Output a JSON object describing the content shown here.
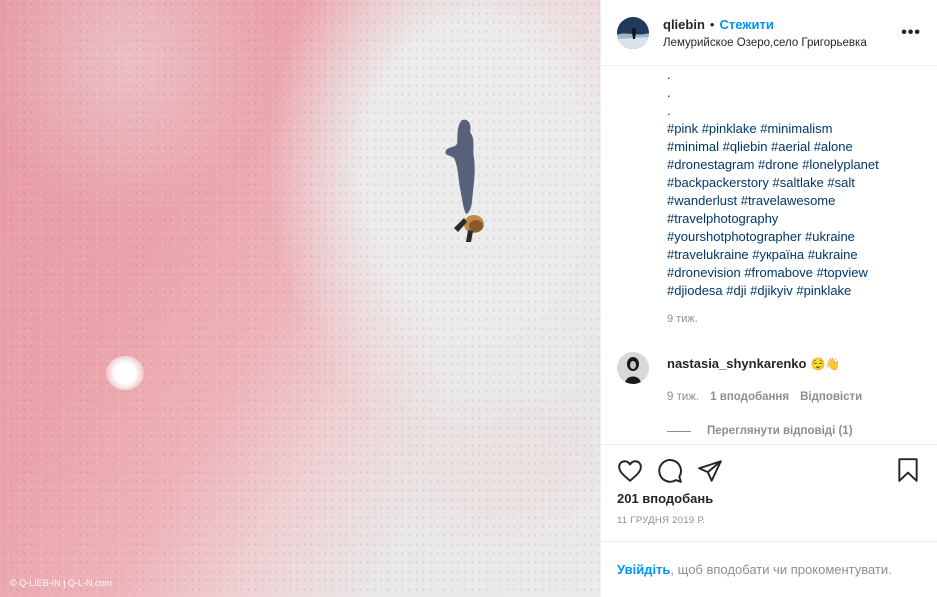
{
  "photo": {
    "watermark": "© Q-LIEB-IN | Q-L-N.com"
  },
  "header": {
    "username": "qliebin",
    "separator": "•",
    "follow_label": "Стежити",
    "location": "Лемурийское Озеро,село Григорьевка",
    "more_label": "•••"
  },
  "caption": {
    "dots": [
      ".",
      ".",
      "."
    ],
    "hashtag_lines": [
      "#pink #pinklake #minimalism",
      "#minimal #qliebin #aerial #alone",
      "#dronestagram #drone #lonelyplanet",
      "#backpackerstory #saltlake #salt",
      "#wanderlust #travelawesome",
      "#travelphotography",
      "#yourshotphotographer #ukraine",
      "#travelukraine #україна #ukraine",
      "#dronevision #fromabove #topview",
      "#djiodesa #dji #djikyiv #pinklake"
    ],
    "time_ago": "9 тиж."
  },
  "comment": {
    "username": "nastasia_shynkarenko",
    "emoji": "😌👋",
    "time_ago": "9 тиж.",
    "likes": "1 вподобання",
    "reply_label": "Відповісти",
    "view_replies": "Переглянути відповіді (1)"
  },
  "actions": {
    "icons": [
      "heart-icon",
      "comment-icon",
      "share-icon",
      "bookmark-icon"
    ],
    "likes_count": "201 вподобань",
    "date": "11 ГРУДНЯ 2019 Р."
  },
  "login_prompt": {
    "link": "Увійдіть",
    "text": ", щоб вподобати чи прокоментувати."
  },
  "colors": {
    "accent_blue": "#0095f6",
    "hashtag_blue": "#00376b",
    "muted_gray": "#8e8e8e"
  }
}
